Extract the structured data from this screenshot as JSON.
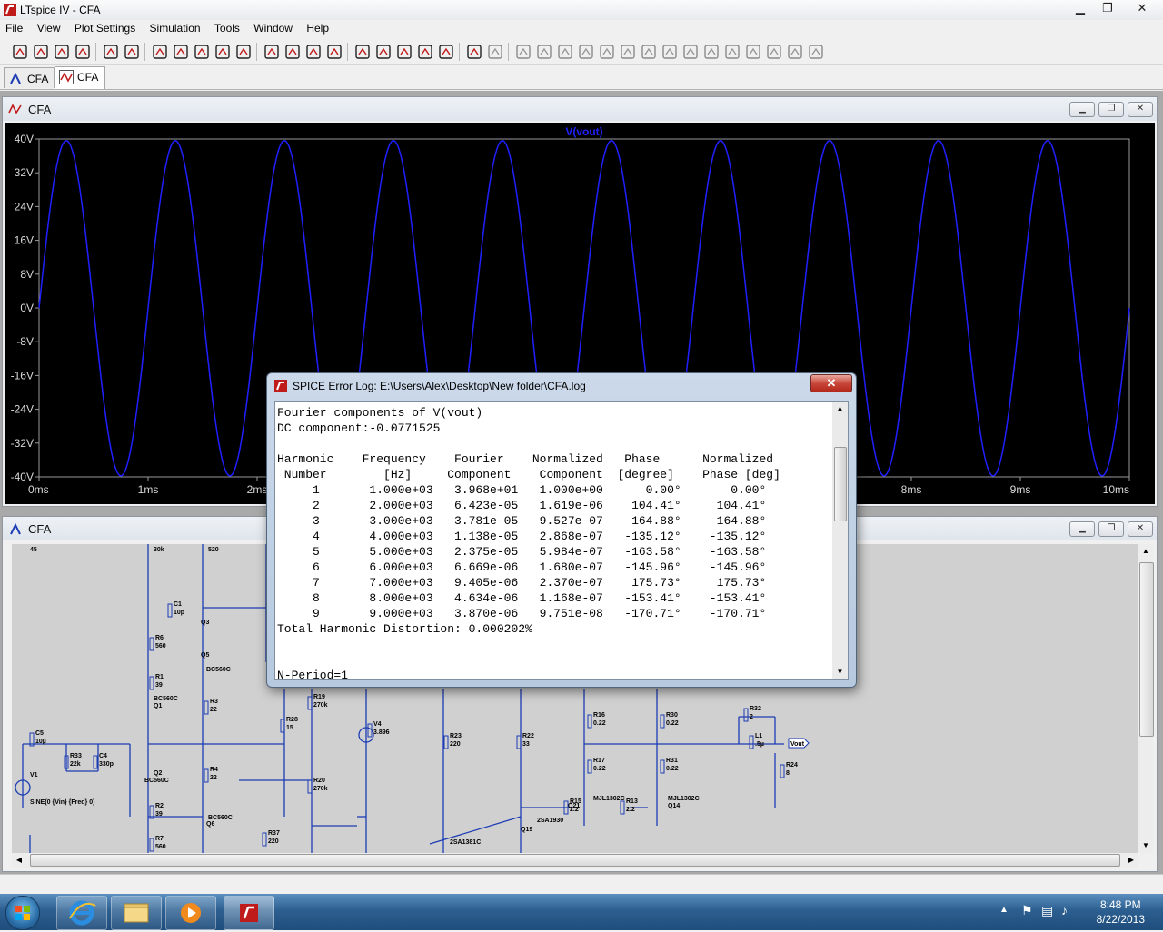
{
  "app": {
    "title": "LTspice IV - CFA"
  },
  "window_controls": {
    "minimize": "▁",
    "restore": "❐",
    "close": "✕"
  },
  "menu": [
    "File",
    "View",
    "Plot Settings",
    "Simulation",
    "Tools",
    "Window",
    "Help"
  ],
  "toolbar_icons": [
    "new-schematic-icon",
    "open-icon",
    "save-icon",
    "control-panel-icon",
    "run-icon",
    "halt-icon",
    "zoom-in-icon",
    "zoom-out-icon",
    "zoom-fit-icon",
    "zoom-cancel-icon",
    "autorange-icon",
    "manual-limits-icon",
    "tile-horizontal-icon",
    "cascade-icon",
    "tile-vertical-icon",
    "cut-icon",
    "copy-icon",
    "paste-icon",
    "find-icon",
    "print-preview-icon",
    "print-icon",
    "wire-icon",
    "ground-icon",
    "label-icon",
    "resistor-icon",
    "capacitor-icon",
    "inductor-icon",
    "diode-icon",
    "component-icon",
    "move-icon",
    "drag-icon",
    "undo-icon",
    "redo-icon",
    "rotate-icon",
    "mirror-icon",
    "text-icon",
    "spice-directive-icon"
  ],
  "tabs": [
    {
      "label": "CFA",
      "icon": "schematic-icon"
    },
    {
      "label": "CFA",
      "icon": "waveform-icon"
    }
  ],
  "plot_window": {
    "title": "CFA",
    "trace_label": "V(vout)",
    "y_ticks": [
      "40V",
      "32V",
      "24V",
      "16V",
      "8V",
      "0V",
      "-8V",
      "-16V",
      "-24V",
      "-32V",
      "-40V"
    ],
    "x_ticks": [
      "0ms",
      "1ms",
      "2ms",
      "3ms",
      "4ms",
      "5ms",
      "6ms",
      "7ms",
      "8ms",
      "9ms",
      "10ms"
    ]
  },
  "chart_data": {
    "type": "line",
    "title": "V(vout)",
    "xlabel": "",
    "ylabel": "",
    "xlim": [
      0,
      10
    ],
    "x_unit": "ms",
    "ylim": [
      -40,
      40
    ],
    "grid": false,
    "series": [
      {
        "name": "V(vout)",
        "color": "#2020ff",
        "function": "sine",
        "amplitude": 39.68,
        "frequency_per_ms": 1,
        "offset": -0.077
      }
    ]
  },
  "schematic_window": {
    "title": "CFA",
    "components": [
      {
        "label": "R15",
        "value": "2.2"
      },
      {
        "label": "R13",
        "value": "2.2"
      },
      {
        "label": "R16",
        "value": "0.22"
      },
      {
        "label": "R17",
        "value": "0.22"
      },
      {
        "label": "R30",
        "value": "0.22"
      },
      {
        "label": "R31",
        "value": "0.22"
      },
      {
        "label": "R32",
        "value": "2"
      },
      {
        "label": "L1",
        "value": ".5µ"
      },
      {
        "label": "R24",
        "value": "8"
      },
      {
        "label": "R22",
        "value": "33"
      },
      {
        "label": "R23",
        "value": "220"
      },
      {
        "label": "R19",
        "value": "270k"
      },
      {
        "label": "R20",
        "value": "270k"
      },
      {
        "label": "R28",
        "value": "15"
      },
      {
        "label": "R37",
        "value": "220"
      },
      {
        "label": "R33",
        "value": "22k"
      },
      {
        "label": "C4",
        "value": "330p"
      },
      {
        "label": "C5",
        "value": "10µ"
      },
      {
        "label": "C1",
        "value": "10p"
      },
      {
        "label": "R6",
        "value": "560"
      },
      {
        "label": "R1",
        "value": "39"
      },
      {
        "label": "R3",
        "value": "22"
      },
      {
        "label": "R4",
        "value": "22"
      },
      {
        "label": "R2",
        "value": "39"
      },
      {
        "label": "R7",
        "value": "560"
      },
      {
        "label": "V4",
        "value": "3.896"
      }
    ],
    "part_labels": [
      "BC560C",
      "BC560C",
      "BC560C",
      "BC560C",
      "Q1",
      "Q2",
      "Q3",
      "Q5",
      "Q6",
      "Q19",
      "Q21",
      "Q14",
      "2SA1930",
      "2SA1381C",
      "MJL1302C",
      "MJL1302C"
    ],
    "top_labels": [
      "45",
      "30k",
      "520"
    ],
    "source_label": "V1",
    "source_value": "SINE(0 {Vin} {Freq} 0)",
    "net_label": "Vout"
  },
  "error_log": {
    "title": "SPICE Error Log: E:\\Users\\Alex\\Desktop\\New folder\\CFA.log",
    "close_label": "✕",
    "lines": [
      "Fourier components of V(vout)",
      "DC component:-0.0771525",
      "",
      "Harmonic    Frequency    Fourier    Normalized   Phase      Normalized",
      " Number        [Hz]     Component    Component  [degree]    Phase [deg]",
      "     1       1.000e+03   3.968e+01   1.000e+00      0.00°       0.00°",
      "     2       2.000e+03   6.423e-05   1.619e-06    104.41°     104.41°",
      "     3       3.000e+03   3.781e-05   9.527e-07    164.88°     164.88°",
      "     4       4.000e+03   1.138e-05   2.868e-07   -135.12°    -135.12°",
      "     5       5.000e+03   2.375e-05   5.984e-07   -163.58°    -163.58°",
      "     6       6.000e+03   6.669e-06   1.680e-07   -145.96°    -145.96°",
      "     7       7.000e+03   9.405e-06   2.370e-07    175.73°     175.73°",
      "     8       8.000e+03   4.634e-06   1.168e-07   -153.41°    -153.41°",
      "     9       9.000e+03   3.870e-06   9.751e-08   -170.71°    -170.71°",
      "Total Harmonic Distortion: 0.000202%",
      "",
      "",
      "N-Period=1"
    ]
  },
  "taskbar": {
    "apps": [
      "start-orb-icon",
      "internet-explorer-icon",
      "file-explorer-icon",
      "media-player-icon",
      "ltspice-icon"
    ],
    "time": "8:48 PM",
    "date": "8/22/2013"
  }
}
